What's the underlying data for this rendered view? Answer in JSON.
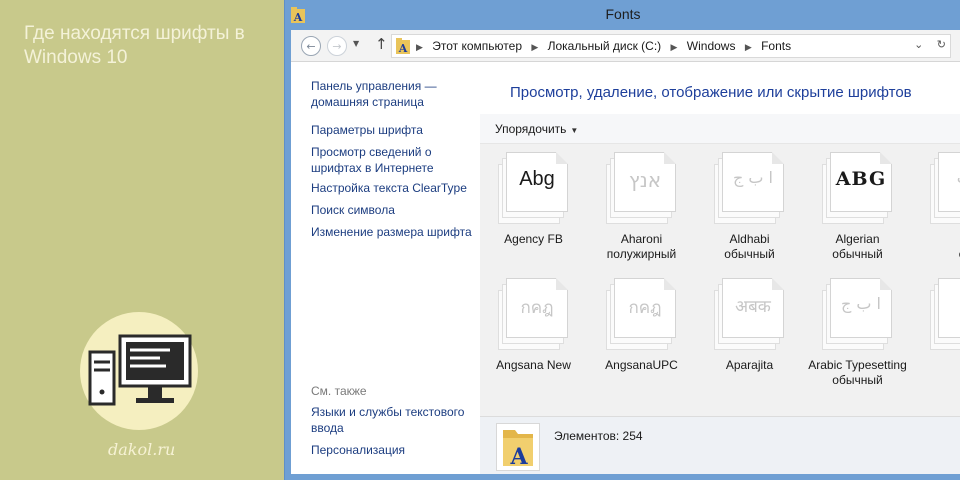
{
  "side": {
    "title": "Где находятся шрифты в Windows 10",
    "site": "dakol.ru"
  },
  "window": {
    "title": "Fonts",
    "breadcrumbs": [
      "Этот компьютер",
      "Локальный диск (C:)",
      "Windows",
      "Fonts"
    ]
  },
  "left_pane": {
    "links": [
      "Панель управления — домашняя страница",
      "Параметры шрифта",
      "Просмотр сведений о шрифтах в Интернете",
      "Настройка текста ClearType",
      "Поиск символа",
      "Изменение размера шрифта"
    ],
    "see_also_label": "См. также",
    "see_also": [
      "Языки и службы текстового ввода",
      "Персонализация"
    ]
  },
  "main": {
    "heading": "Просмотр, удаление, отображение или скрытие шрифтов",
    "organize_label": "Упорядочить"
  },
  "fonts": [
    {
      "name": "Agency FB",
      "sample": "Abg",
      "style": "",
      "active": true
    },
    {
      "name": "Aharoni",
      "sample": "אנץ",
      "style": "полужирный",
      "active": false
    },
    {
      "name": "Aldhabi",
      "sample": "ا ب ج",
      "style": "обычный",
      "active": false
    },
    {
      "name": "Algerian",
      "sample": "ABG",
      "style": "обычный",
      "active": true
    },
    {
      "name": "A",
      "sample": "ا ب",
      "style": "об",
      "active": false
    },
    {
      "name": "Angsana New",
      "sample": "กคฎ",
      "style": "",
      "active": false
    },
    {
      "name": "AngsanaUPC",
      "sample": "กคฎ",
      "style": "",
      "active": false
    },
    {
      "name": "Aparajita",
      "sample": "अबक",
      "style": "",
      "active": false
    },
    {
      "name": "Arabic Typesetting",
      "sample": "ا ب ج",
      "style": "обычный",
      "active": false
    },
    {
      "name": "",
      "sample": "A",
      "style": "",
      "active": true
    }
  ],
  "details": {
    "text": "Элементов: 254"
  },
  "colors": {
    "side_bg": "#c8c98b",
    "window_frame": "#6f9fd3",
    "heading": "#1e3f9b",
    "link": "#1c3d80"
  }
}
